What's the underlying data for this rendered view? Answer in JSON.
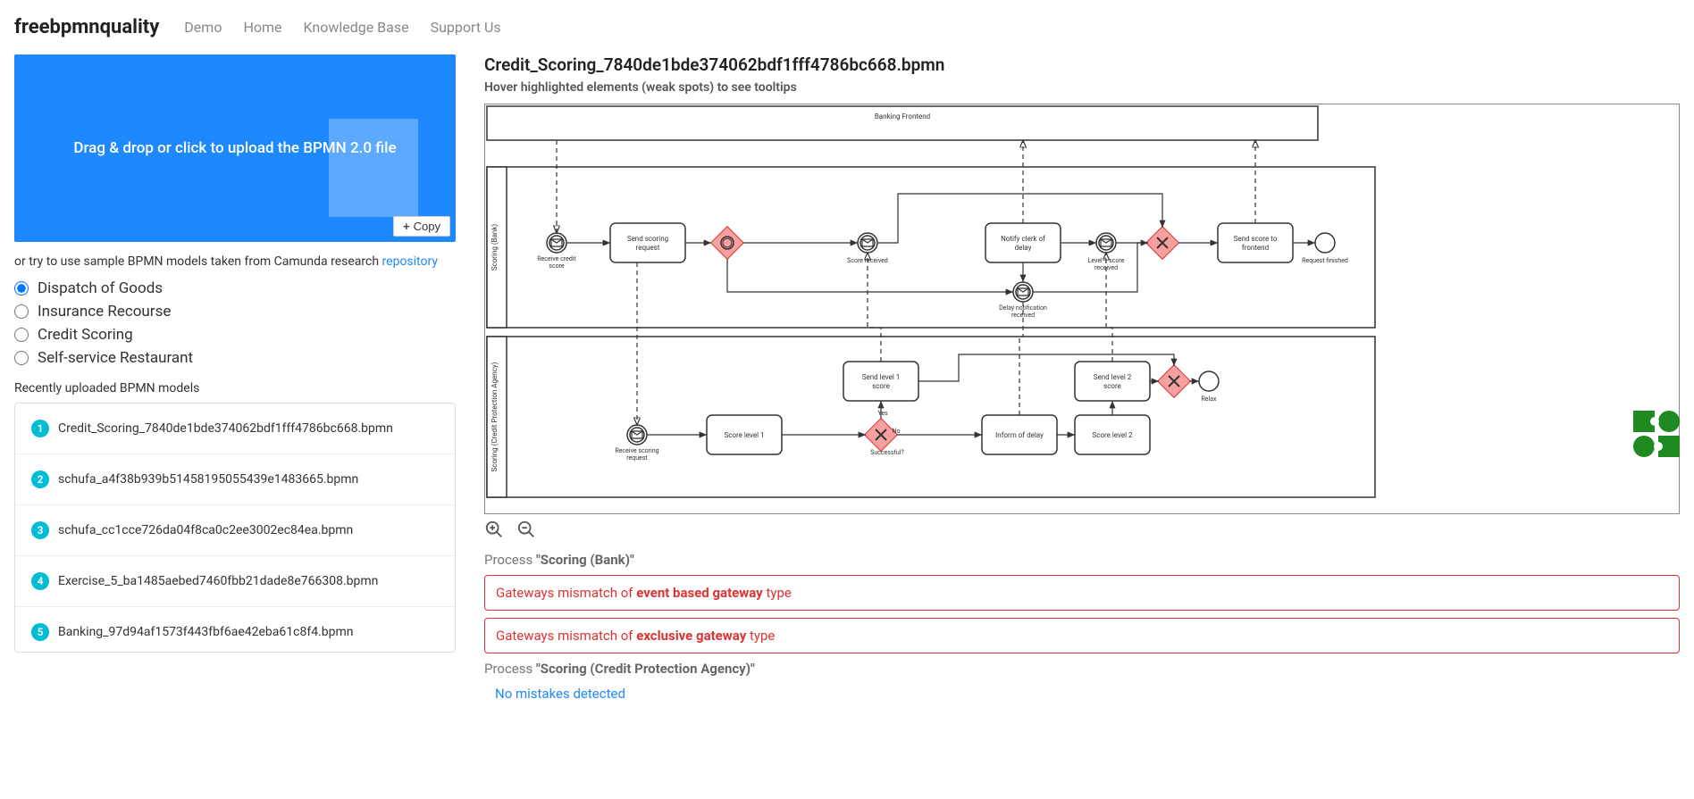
{
  "nav": {
    "brand": "freebpmnquality",
    "links": [
      "Demo",
      "Home",
      "Knowledge Base",
      "Support Us"
    ]
  },
  "dropzone": {
    "text": "Drag & drop or click to upload the BPMN 2.0 file",
    "copy": "Copy"
  },
  "sample": {
    "prefix": "or try to use sample BPMN models taken from Camunda research ",
    "link": "repository",
    "options": [
      "Dispatch of Goods",
      "Insurance Recourse",
      "Credit Scoring",
      "Self-service Restaurant"
    ],
    "selected": 0
  },
  "recent": {
    "label": "Recently uploaded BPMN models",
    "items": [
      "Credit_Scoring_7840de1bde374062bdf1fff4786bc668.bpmn",
      "schufa_a4f38b939b51458195055439e1483665.bpmn",
      "schufa_cc1cce726da04f8ca0c2ee3002ec84ea.bpmn",
      "Exercise_5_ba1485aebed7460fbb21dade8e766308.bpmn",
      "Banking_97d94af1573f443fbf6ae42eba61c8f4.bpmn"
    ]
  },
  "file": {
    "title": "Credit_Scoring_7840de1bde374062bdf1fff4786bc668.bpmn",
    "hint": "Hover highlighted elements (weak spots) to see tooltips"
  },
  "diagram": {
    "pool_top": "Banking Frontend",
    "lane1": "Scoring (Bank)",
    "lane2": "Scoring (Credit Protection Agency)",
    "lane1_elements": {
      "receive_credit_score": "Receive credit\nscore",
      "send_scoring_request": "Send scoring\nrequest",
      "score_received": "Score received",
      "notify_clerk": "Notify clerk of\ndelay",
      "level1_score_received": "Level 1 score\nreceived",
      "delay_notification": "Delay notification\nreceived",
      "send_score_frontend": "Send score to\nfrontend",
      "request_finished": "Request finished"
    },
    "lane2_elements": {
      "receive_scoring_request": "Receive scoring\nrequest",
      "score_level_1": "Score level 1",
      "yes": "Yes",
      "no": "No",
      "successful": "Successful?",
      "send_level1_score": "Send level 1\nscore",
      "inform_delay": "Inform of delay",
      "score_level_2": "Score level 2",
      "send_level2_score": "Send level 2\nscore",
      "relax": "Relax"
    }
  },
  "results": {
    "process1": {
      "prefix": "Process ",
      "name": "\"Scoring (Bank)\""
    },
    "errors": [
      {
        "prefix": "Gateways mismatch of ",
        "bold": "event based gateway",
        "suffix": " type"
      },
      {
        "prefix": "Gateways mismatch of ",
        "bold": "exclusive gateway",
        "suffix": " type"
      }
    ],
    "process2": {
      "prefix": "Process ",
      "name": "\"Scoring (Credit Protection Agency)\""
    },
    "ok": "No mistakes detected"
  }
}
